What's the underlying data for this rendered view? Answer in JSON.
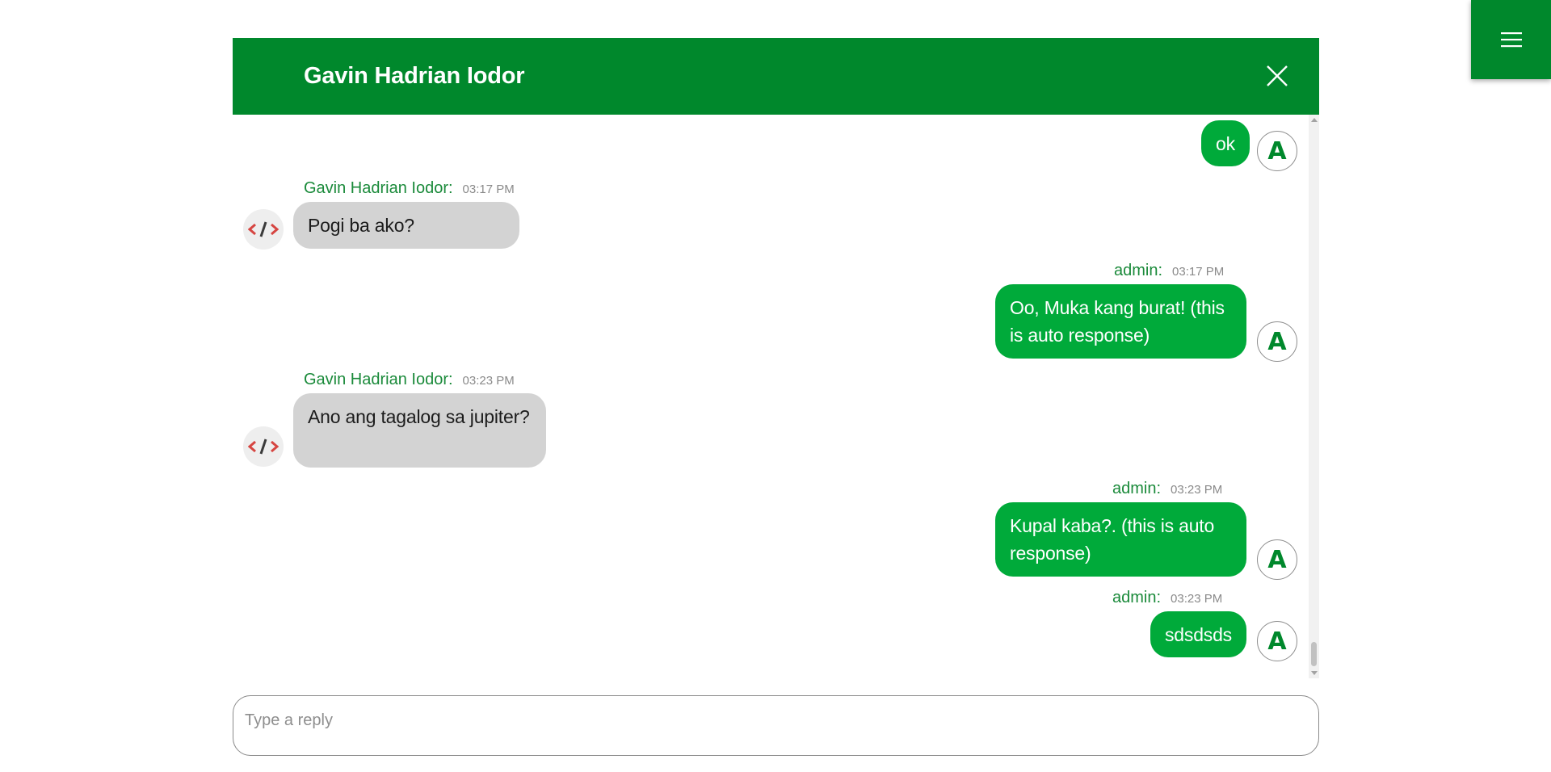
{
  "header": {
    "title": "Gavin Hadrian Iodor",
    "close_icon": "close-icon",
    "menu_icon": "hamburger-menu-icon"
  },
  "messages": [
    {
      "direction": "out",
      "sender": "",
      "time": "",
      "text": "ok",
      "avatar": "A"
    },
    {
      "direction": "in",
      "sender": "Gavin Hadrian Iodor:",
      "time": "03:17 PM",
      "text": "Pogi ba ako?",
      "avatar_icon": "code-icon"
    },
    {
      "direction": "out",
      "sender": "admin:",
      "time": "03:17 PM",
      "text": "Oo, Muka kang burat! (this is auto response)",
      "avatar": "A"
    },
    {
      "direction": "in",
      "sender": "Gavin Hadrian Iodor:",
      "time": "03:23 PM",
      "text": "Ano ang tagalog sa jupiter?",
      "avatar_icon": "code-icon"
    },
    {
      "direction": "out",
      "sender": "admin:",
      "time": "03:23 PM",
      "text": "Kupal kaba?. (this is auto response)",
      "avatar": "A"
    },
    {
      "direction": "out",
      "sender": "admin:",
      "time": "03:23 PM",
      "text": "sdsdsds",
      "avatar": "A"
    }
  ],
  "reply": {
    "placeholder": "Type a reply",
    "value": ""
  },
  "colors": {
    "header_green": "#00882c",
    "outgoing_bubble": "#00aa3a",
    "incoming_bubble": "#d3d3d3",
    "sender_name": "#1a8a3a"
  }
}
